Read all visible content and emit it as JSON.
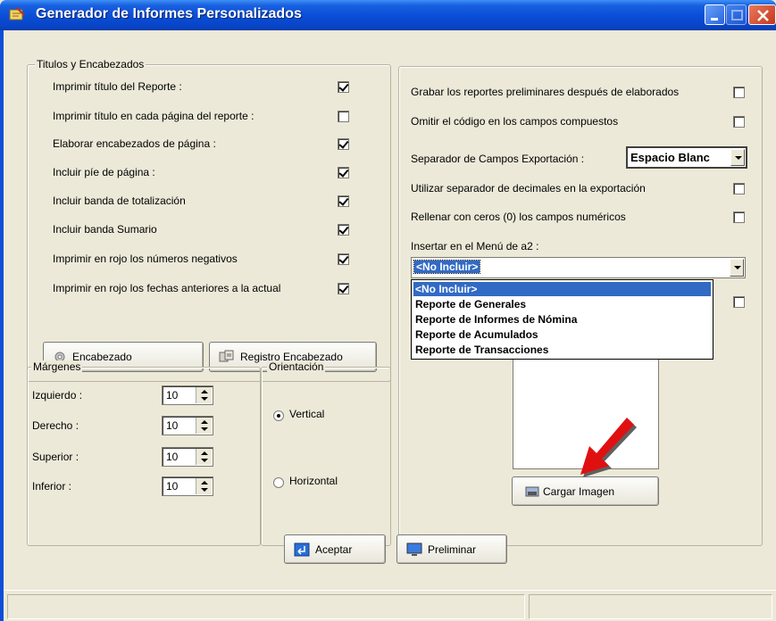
{
  "window": {
    "title": "Generador de Informes Personalizados"
  },
  "titulos": {
    "legend": "Titulos y Encabezados",
    "options": [
      {
        "label": "Imprimir título del Reporte :",
        "checked": true
      },
      {
        "label": "Imprimir título en cada página del reporte :",
        "checked": false
      },
      {
        "label": "Elaborar encabezados de página :",
        "checked": true
      },
      {
        "label": "Incluir píe de página :",
        "checked": true
      },
      {
        "label": "Incluir banda de totalización",
        "checked": true
      },
      {
        "label": "Incluir banda Sumario",
        "checked": true
      },
      {
        "label": "Imprimir en rojo los números negativos",
        "checked": true
      },
      {
        "label": "Imprimir en rojo los fechas anteriores a la actual",
        "checked": true
      }
    ],
    "encabezado_button": "Encabezado",
    "registro_button": "Registro Encabezado"
  },
  "margenes": {
    "legend": "Márgenes",
    "fields": [
      {
        "label": "Izquierdo :",
        "value": "10"
      },
      {
        "label": "Derecho :",
        "value": "10"
      },
      {
        "label": "Superior :",
        "value": "10"
      },
      {
        "label": "Inferior :",
        "value": "10"
      }
    ]
  },
  "orientacion": {
    "legend": "Orientación",
    "options": [
      {
        "label": "Vertical",
        "selected": true
      },
      {
        "label": "Horizontal",
        "selected": false
      }
    ]
  },
  "right": {
    "options": [
      {
        "label": "Grabar los reportes preliminares después de elaborados",
        "checked": false
      },
      {
        "label": "Omitir el código en los campos compuestos",
        "checked": false
      }
    ],
    "separador_label": "Separador de Campos Exportación :",
    "separador_value": "Espacio Blanc",
    "options2": [
      {
        "label": "Utilizar separador de decimales en la exportación",
        "checked": false
      },
      {
        "label": "Rellenar con ceros (0) los campos numéricos",
        "checked": false
      }
    ],
    "menu_label": "Insertar en  el Menú de a2 :",
    "menu_value": "<No Incluir>",
    "menu_options": [
      "<No Incluir>",
      "Reporte de Generales",
      "Reporte de Informes de Nómina",
      "Reporte de Acumulados",
      "Reporte de Transacciones"
    ],
    "cargar_button": "Cargar Imagen"
  },
  "footer": {
    "aceptar": "Aceptar",
    "preliminar": "Preliminar"
  },
  "colors": {
    "titlebar": "#0a4fd8",
    "face": "#ece9d8",
    "selection": "#316ac5",
    "arrow": "#e01010"
  }
}
